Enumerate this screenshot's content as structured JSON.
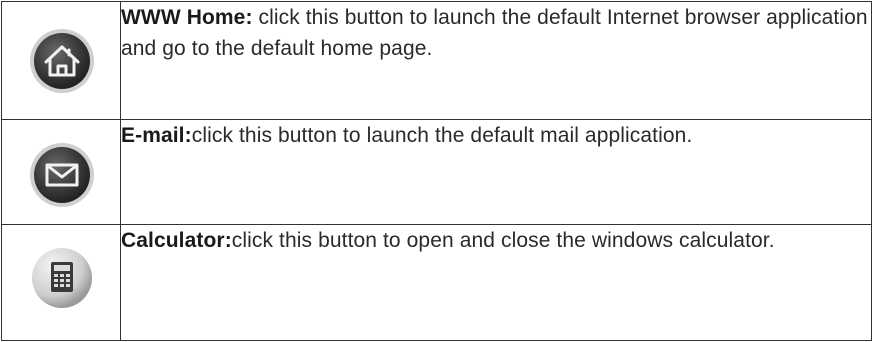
{
  "rows": [
    {
      "term": "WWW  Home:",
      "description": " click this button to launch the default Internet browser application and go to the default home page.",
      "icon": "home-icon"
    },
    {
      "term": "E-mail:",
      "description": "click this button to launch the default mail application.",
      "icon": "mail-icon"
    },
    {
      "term": "Calculator:",
      "description": "click this button to open and close the windows calculator.",
      "icon": "calculator-icon"
    }
  ],
  "colors": {
    "border": "#333333",
    "button_dark": "#3c3c3c",
    "button_light": "#d8d8d8",
    "text": "#2a2a2a"
  }
}
